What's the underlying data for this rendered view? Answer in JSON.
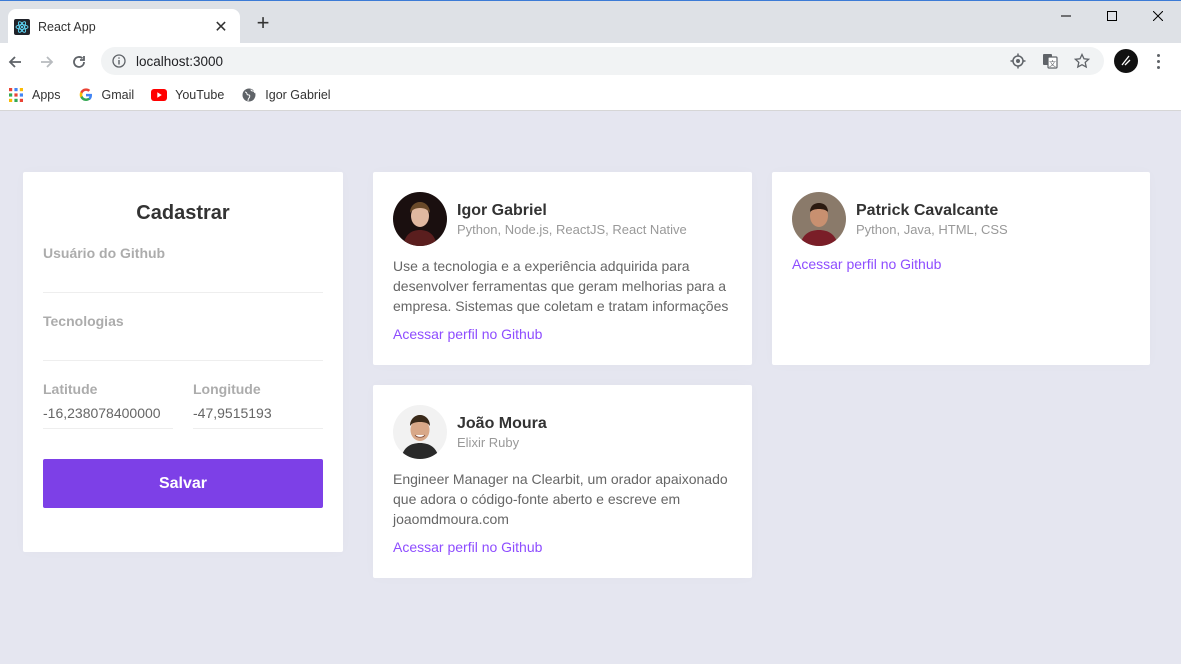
{
  "browser": {
    "tab_title": "React App",
    "url": "localhost:3000",
    "bookmarks": [
      {
        "label": "Apps",
        "icon": "apps-grid-icon"
      },
      {
        "label": "Gmail",
        "icon": "google-icon"
      },
      {
        "label": "YouTube",
        "icon": "youtube-icon"
      },
      {
        "label": "Igor Gabriel",
        "icon": "globe-icon"
      }
    ]
  },
  "form": {
    "title": "Cadastrar",
    "github_label": "Usuário do Github",
    "github_value": "",
    "techs_label": "Tecnologias",
    "techs_value": "",
    "latitude_label": "Latitude",
    "latitude_value": "-16,238078400000",
    "longitude_label": "Longitude",
    "longitude_value": "-47,9515193",
    "save_label": "Salvar"
  },
  "devs": [
    {
      "name": "Igor Gabriel",
      "techs": "Python, Node.js, ReactJS, React Native",
      "bio": "Use a tecnologia e a experiência adquirida para desenvolver ferramentas que geram melhorias para a empresa. Sistemas que coletam e tratam informações",
      "link_label": "Acessar perfil no Github"
    },
    {
      "name": "Patrick Cavalcante",
      "techs": "Python, Java, HTML, CSS",
      "bio": "",
      "link_label": "Acessar perfil no Github"
    },
    {
      "name": "João Moura",
      "techs": "Elixir Ruby",
      "bio": "Engineer Manager na Clearbit, um orador apaixonado que adora o código-fonte aberto e escreve em joaomdmoura.com",
      "link_label": "Acessar perfil no Github"
    }
  ],
  "colors": {
    "accent": "#7d40e7",
    "link": "#8e4dff",
    "background": "#e5e6f0"
  }
}
